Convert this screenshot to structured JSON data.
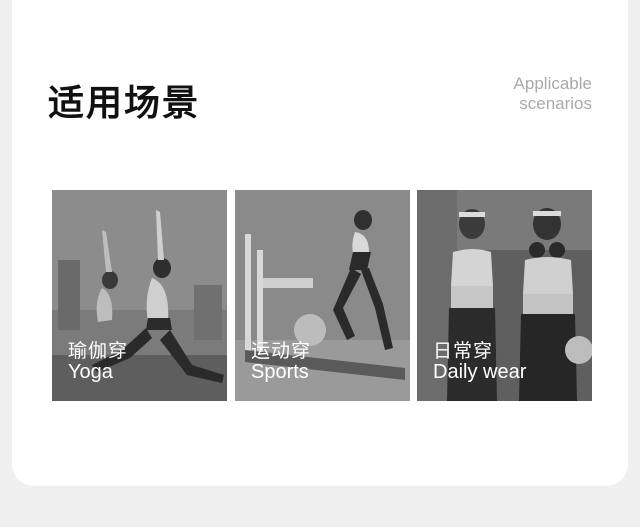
{
  "section": {
    "title": "适用场景",
    "subtitle_line1": "Applicable",
    "subtitle_line2": "scenarios"
  },
  "scenarios": [
    {
      "label_zh": "瑜伽穿",
      "label_en": "Yoga",
      "photo": "yoga-pose-photo"
    },
    {
      "label_zh": "运动穿",
      "label_en": "Sports",
      "photo": "treadmill-running-photo"
    },
    {
      "label_zh": "日常穿",
      "label_en": "Daily wear",
      "photo": "street-casual-photo"
    }
  ]
}
